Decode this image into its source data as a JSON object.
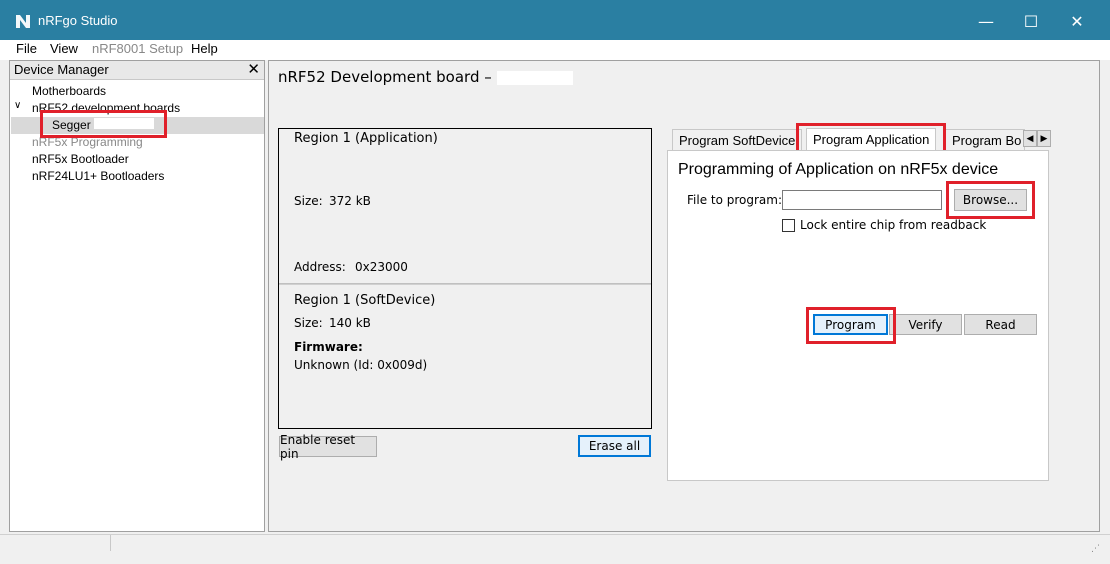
{
  "window": {
    "title": "nRFgo Studio",
    "minimize_glyph": "—",
    "maximize_glyph": "☐",
    "close_glyph": "✕",
    "accent_color": "#2a7fa2"
  },
  "menu": {
    "file": "File",
    "view": "View",
    "setup": "nRF8001 Setup",
    "help": "Help"
  },
  "device_manager": {
    "header": "Device Manager",
    "close_glyph": "✕",
    "items": {
      "motherboards": "Motherboards",
      "dev_boards": "nRF52 development boards",
      "segger": "Segger",
      "programming": "nRF5x Programming",
      "bootloader": "nRF5x Bootloader",
      "nrf24": "nRF24LU1+ Bootloaders"
    }
  },
  "board": {
    "title": "nRF52 Development board –"
  },
  "regions": {
    "app_title": "Region 1 (Application)",
    "app_size_label": "Size:",
    "app_size_value": "372 kB",
    "app_address_label": "Address:",
    "app_address_value": "0x23000",
    "sd_title": "Region 1 (SoftDevice)",
    "sd_size_label": "Size:",
    "sd_size_value": "140 kB",
    "firmware_label": "Firmware:",
    "firmware_value": "Unknown (Id: 0x009d)"
  },
  "buttons": {
    "enable_reset": "Enable reset pin",
    "erase_all": "Erase all",
    "browse": "Browse...",
    "program": "Program",
    "verify": "Verify",
    "read": "Read"
  },
  "tabs": {
    "softdevice": "Program SoftDevice",
    "application": "Program Application",
    "bootloader": "Program Bo",
    "scroll_left": "◀",
    "scroll_right": "▶"
  },
  "program_pane": {
    "title": "Programming of Application on nRF5x device",
    "file_label": "File to program:",
    "file_value": "",
    "lock_label": "Lock entire chip from readback",
    "lock_checked": false
  },
  "status": {
    "grip": "⋰"
  },
  "highlight_color": "#e0202a"
}
